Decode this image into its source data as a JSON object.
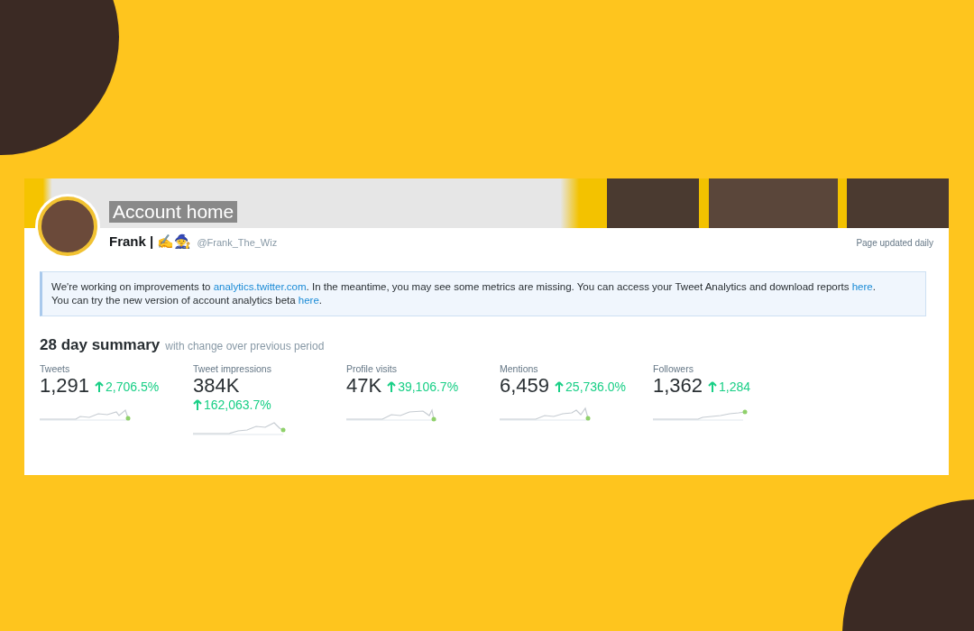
{
  "header": {
    "title": "Account home",
    "name": "Frank | ✍️🧙",
    "handle": "@Frank_The_Wiz",
    "updated": "Page updated daily"
  },
  "notice": {
    "line_1_before": "We're working on improvements to ",
    "line_1_link": "analytics.twitter.com",
    "line_1_middle": ". In the meantime, you may see some metrics are missing. You can access your Tweet Analytics and download reports ",
    "line_1_link_2": "here",
    "line_1_end": ".",
    "line_2_before": "You can try the new version of account analytics beta ",
    "line_2_link": "here",
    "line_2_end": "."
  },
  "summary": {
    "title": "28 day summary",
    "subtitle": "with change over previous period",
    "metrics": [
      {
        "label": "Tweets",
        "value": "1,291",
        "change": "2,706.5%"
      },
      {
        "label": "Tweet impressions",
        "value": "384K",
        "change": "162,063.7%"
      },
      {
        "label": "Profile visits",
        "value": "47K",
        "change": "39,106.7%"
      },
      {
        "label": "Mentions",
        "value": "6,459",
        "change": "25,736.0%"
      },
      {
        "label": "Followers",
        "value": "1,362",
        "change": "1,284"
      }
    ]
  }
}
